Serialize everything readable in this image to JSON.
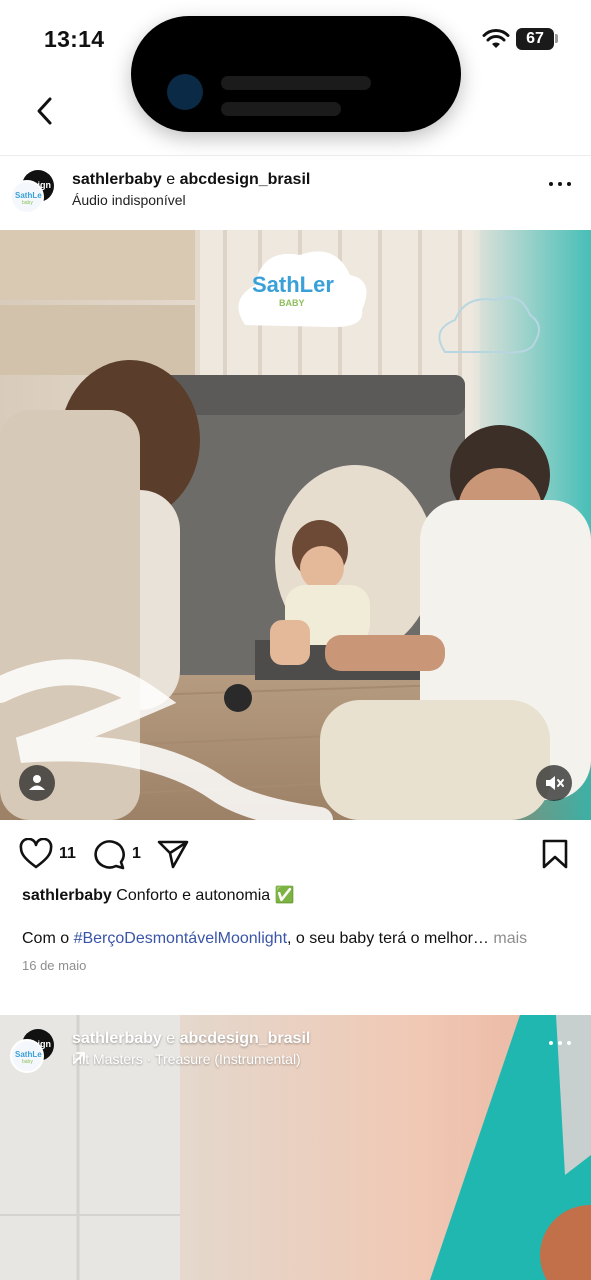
{
  "status_bar": {
    "time": "13:14",
    "battery": "67"
  },
  "nav": {
    "back_icon": "chevron-left-icon"
  },
  "post1": {
    "user1": "sathlerbaby",
    "connector": "e",
    "user2": "abcdesign_brasil",
    "subtitle": "Áudio indisponível",
    "avatar_back_text": "design",
    "avatar_front_text": "SathLer",
    "avatar_front_sub": "baby",
    "photo_logo": "SathLer",
    "photo_logo_sub": "BABY",
    "likes": "11",
    "comments": "1",
    "caption_user": "sathlerbaby",
    "caption_text": "Conforto e autonomia ✅",
    "caption2_prefix": "Com o ",
    "caption2_tag": "#BerçoDesmontávelMoonlight",
    "caption2_suffix": ", o seu baby terá o melhor…",
    "caption2_more": "mais",
    "date": "16 de maio"
  },
  "post2": {
    "user1": "sathlerbaby",
    "connector": "e",
    "user2": "abcdesign_brasil",
    "music_icon": "arrow-up-right-icon",
    "music": "Hit Masters · Treasure (Instrumental)",
    "avatar_back_text": "design",
    "avatar_front_text": "SathLer",
    "avatar_front_sub": "baby"
  },
  "colors": {
    "hashtag": "#3a55a8",
    "muted": "#8e8e8e",
    "teal_accent": "#2bb8b0"
  }
}
